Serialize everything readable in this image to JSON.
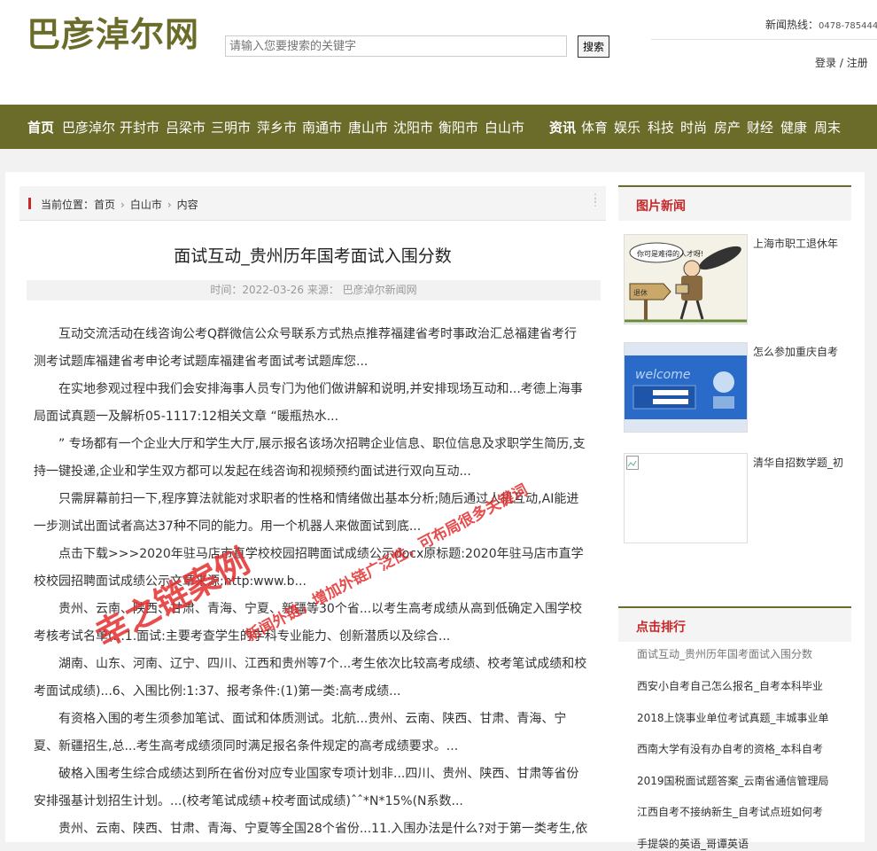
{
  "site": {
    "logo": "巴彦淖尔网",
    "search_placeholder": "请输入您要搜索的关键字",
    "search_button": "搜索",
    "hotline_label": "新闻热线：",
    "hotline_number": "0478-785444",
    "login": "登录",
    "auth_sep": " / ",
    "register": "注册"
  },
  "nav": {
    "items": [
      "首页",
      "巴彦淖尔",
      "开封市",
      "吕梁市",
      "三明市",
      "萍乡市",
      "南通市",
      "唐山市",
      "沈阳市",
      "衡阳市",
      "白山市",
      "资讯",
      "体育",
      "娱乐",
      "科技",
      "时尚",
      "房产",
      "财经",
      "健康",
      "周末"
    ]
  },
  "breadcrumb": {
    "label": "当前位置：",
    "home": "首页",
    "category": "白山市",
    "current": "内容"
  },
  "article": {
    "title": "面试互动_贵州历年国考面试入围分数",
    "meta": "时间：2022-03-26 来源： 巴彦淖尔新闻网",
    "paragraphs": [
      "互动交流活动在线咨询公考Q群微信公众号联系方式热点推荐福建省考时事政治汇总福建省考行测考试题库福建省考申论考试题库福建省考面试考试题库您...",
      "在实地参观过程中我们会安排海事人员专门为他们做讲解和说明,并安排现场互动和...考德上海事局面试真题一及解析05-1117:12相关文章 “暖瓶热水...",
      "” 专场都有一个企业大厅和学生大厅,展示报名该场次招聘企业信息、职位信息及求职学生简历,支持一键投递,企业和学生双方都可以发起在线咨询和视频预约面试进行双向互动...",
      "只需屏幕前扫一下,程序算法就能对求职者的性格和情绪做出基本分析;随后通过人机互动,AI能进一步测试出面试者高达37种不同的能力。用一个机器人来做面试到底...",
      "点击下载>>>2020年驻马店市直学校校园招聘面试成绩公示docx原标题:2020年驻马店市直学校校园招聘面试成绩公示文章来源:http:www.b...",
      "贵州、云南、陕西、甘肃、青海、宁夏、新疆等30个省...以考生高考成绩从高到低确定入围学校考核考试名单(...1.面试:主要考查学生的学科专业能力、创新潜质以及综合...",
      "湖南、山东、河南、辽宁、四川、江西和贵州等7个...考生依次比较高考成绩、校考笔试成绩和校考面试成绩)...6、入围比例:1:37、报考条件:(1)第一类:高考成绩...",
      "有资格入围的考生须参加笔试、面试和体质测试。北航...贵州、云南、陕西、甘肃、青海、宁夏、新疆招生,总...考生高考成绩须同时满足报名条件规定的高考成绩要求。...",
      "破格入围考生综合成绩达到所在省份对应专业国家专项计划非...四川、贵州、陕西、甘肃等省份安排强基计划招生计划。...(校考笔试成绩+校考面试成绩)ˆˆ*N*15%(N系数...",
      "贵州、云南、陕西、甘肃、青海、宁夏等全国28个省份...11.入围办法是什么?对于第一类考生,依"
    ]
  },
  "sidebar": {
    "pic_news_title": "图片新闻",
    "pic_news": [
      {
        "caption": "上海市职工退休年",
        "icon": "cartoon-image"
      },
      {
        "caption": "怎么参加重庆自考",
        "icon": "login-screen-image"
      },
      {
        "caption": "清华自招数学题_初",
        "icon": "broken-image"
      }
    ],
    "rank_title": "点击排行",
    "rank": [
      "面试互动_贵州历年国考面试入围分数",
      "西安小自考自己怎么报名_自考本科毕业",
      "2018上饶事业单位考试真题_丰城事业单",
      "西南大学有没有办自考的资格_本科自考",
      "2019国税面试题答案_云南省通信管理局",
      "江西自考不接纳新生_自考试点班如何考",
      "手提袋的英语_哥谭英语"
    ]
  },
  "watermark": {
    "line1": "幸之链案例",
    "line2": "新闻外链，增加外链广泛性，可布局很多关键词"
  },
  "colors": {
    "brand": "#6b6b2a",
    "accent": "#c62828",
    "watermark": "#e53030"
  }
}
